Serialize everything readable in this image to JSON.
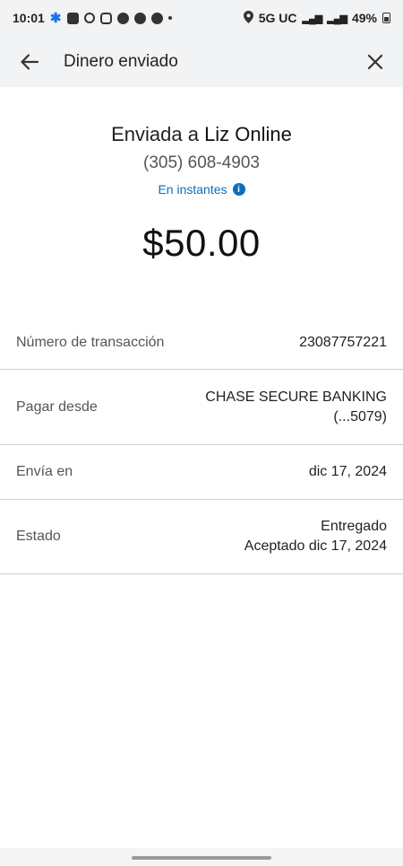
{
  "status_bar": {
    "time": "10:01",
    "network": "5G UC",
    "battery": "49%"
  },
  "header": {
    "title": "Dinero enviado"
  },
  "summary": {
    "sent_prefix": "Enviada a",
    "recipient_name": "Liz Online",
    "phone": "(305) 608-4903",
    "speed_label": "En instantes",
    "amount": "$50.00"
  },
  "details": {
    "rows": [
      {
        "label": "Número de transacción",
        "value_line1": "23087757221",
        "value_line2": ""
      },
      {
        "label": "Pagar desde",
        "value_line1": "CHASE SECURE BANKING",
        "value_line2": "(...5079)"
      },
      {
        "label": "Envía en",
        "value_line1": "dic 17, 2024",
        "value_line2": ""
      },
      {
        "label": "Estado",
        "value_line1": "Entregado",
        "value_line2": "Aceptado dic 17, 2024"
      }
    ]
  },
  "colors": {
    "accent_blue": "#0a6ebd",
    "header_bg": "#f2f3f5"
  }
}
